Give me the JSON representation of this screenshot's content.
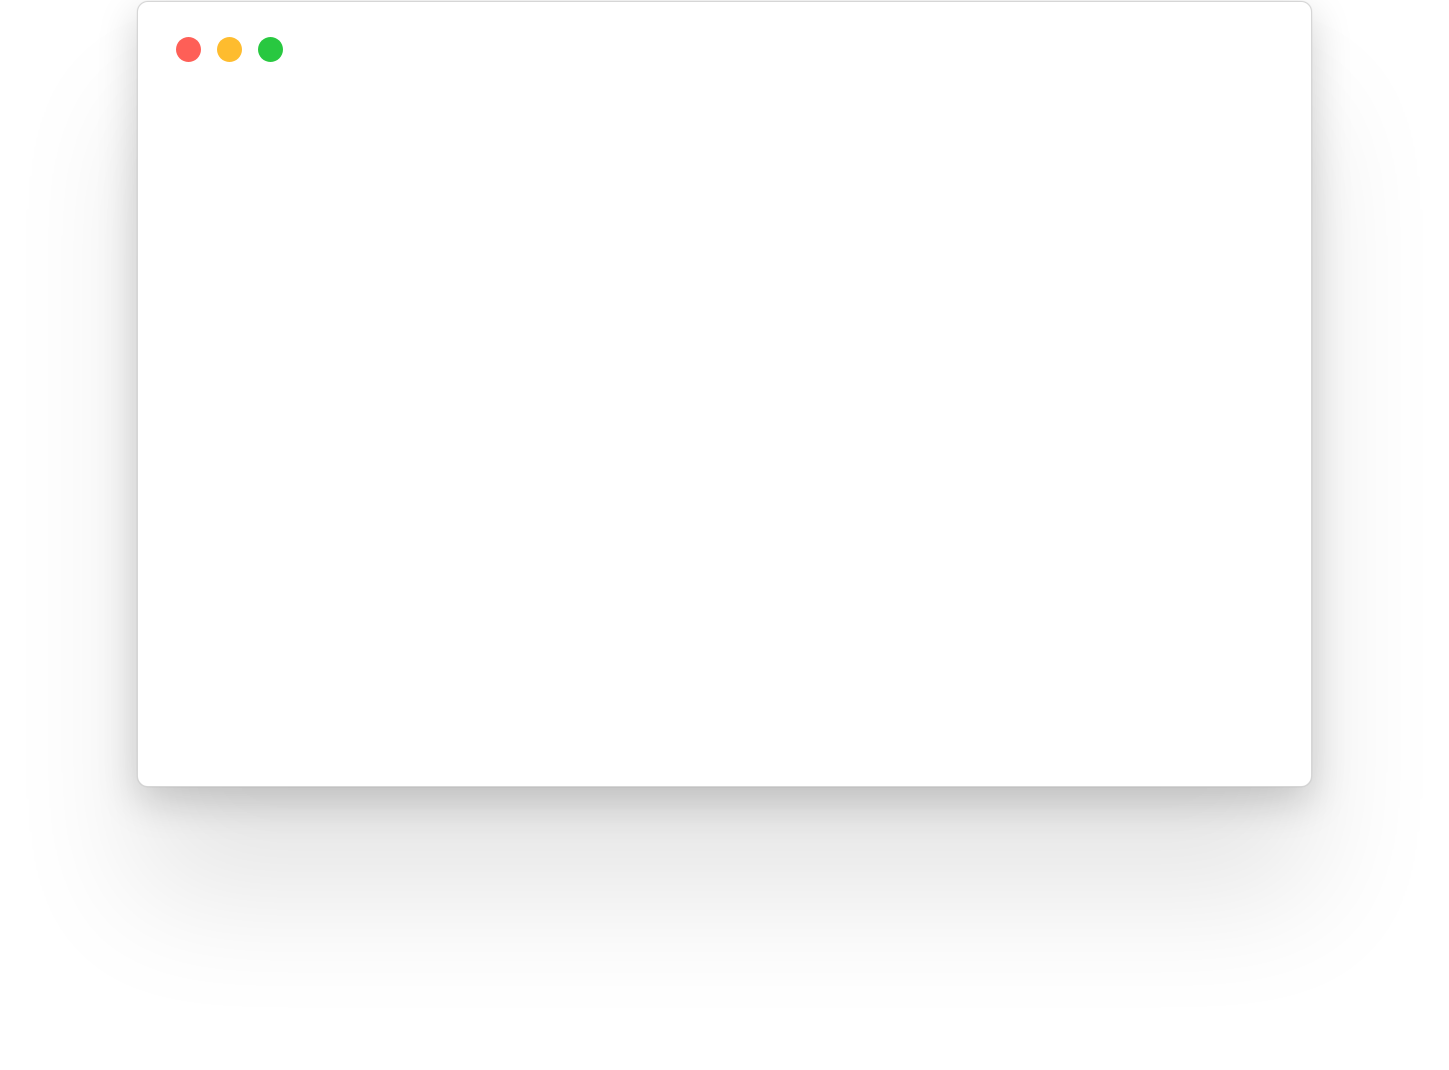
{
  "window": {
    "title": "",
    "controls": [
      {
        "name": "close",
        "color": "#fe5f57",
        "icon": "close-icon"
      },
      {
        "name": "minimize",
        "color": "#febc2e",
        "icon": "minimize-icon"
      },
      {
        "name": "zoom",
        "color": "#28c840",
        "icon": "zoom-icon"
      }
    ]
  },
  "content": {
    "text": ""
  }
}
